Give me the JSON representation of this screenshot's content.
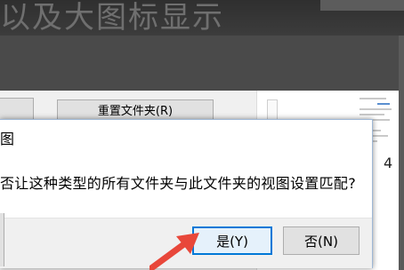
{
  "background": {
    "title_fragment": "以及大图标显示",
    "reset_folder_button": "重置文件夹(R)",
    "page_number": "4"
  },
  "dialog": {
    "title": "图",
    "message": "否让这种类型的所有文件夹与此文件夹的视图设置匹配?",
    "yes_label": "是(Y)",
    "no_label": "否(N)"
  },
  "colors": {
    "arrow": "#e8473a",
    "focus_border": "#0078d7"
  }
}
